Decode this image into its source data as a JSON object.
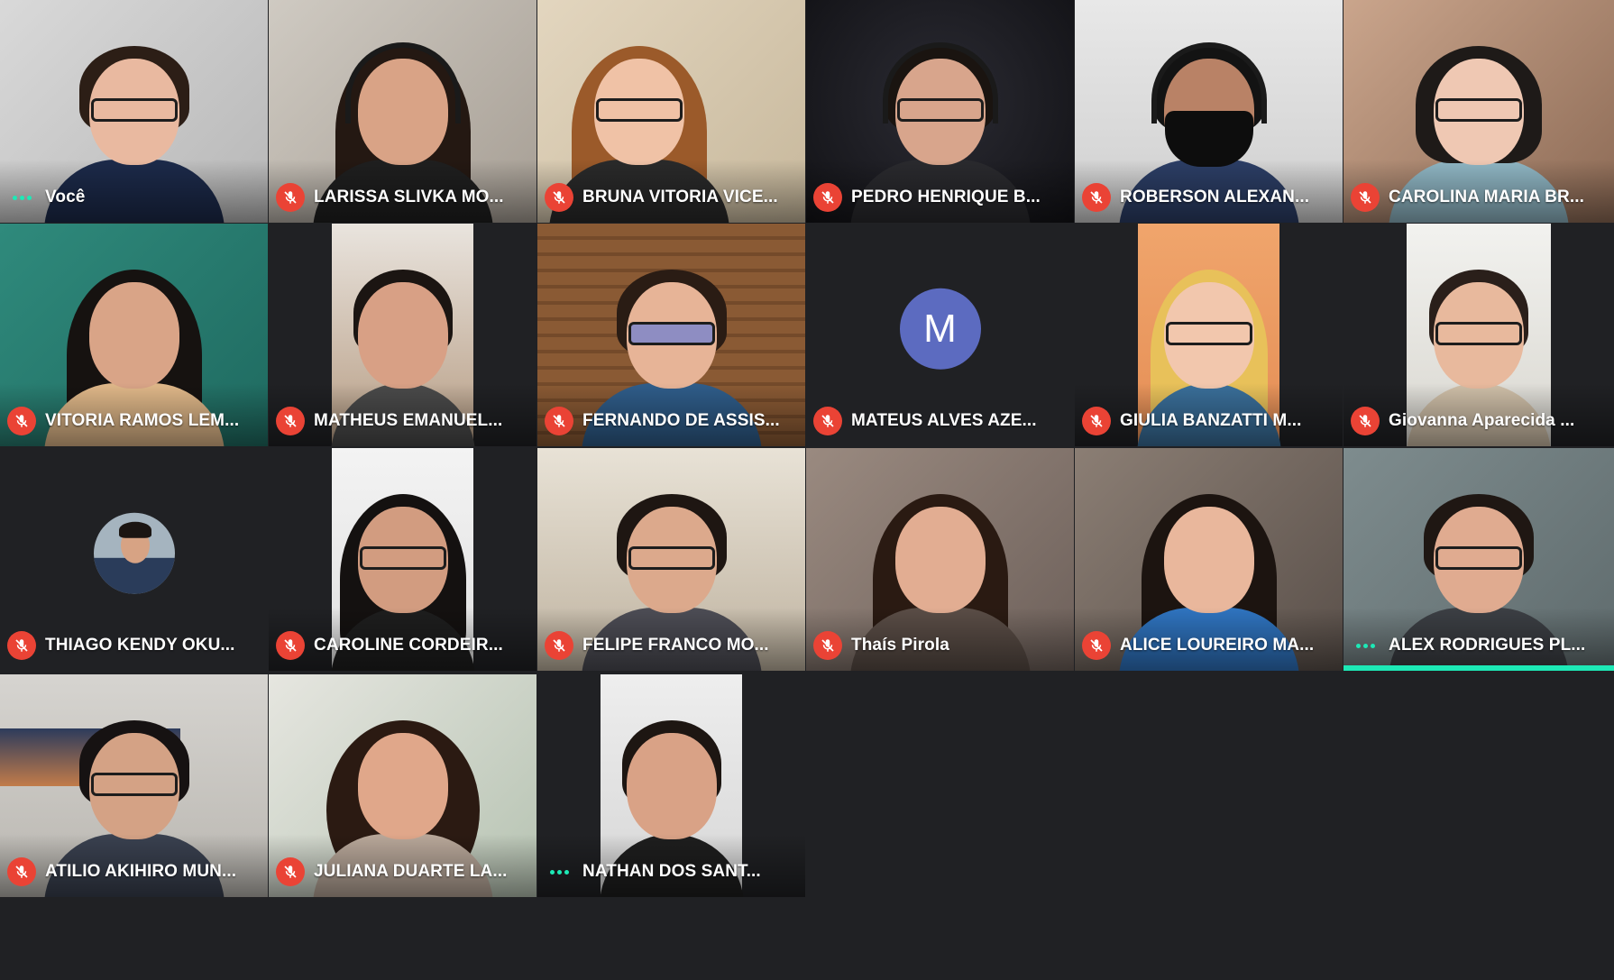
{
  "meeting": {
    "participants": [
      {
        "name": "Você",
        "status": "speaking"
      },
      {
        "name": "LARISSA SLIVKA MO...",
        "status": "muted"
      },
      {
        "name": "BRUNA VITORIA VICE...",
        "status": "muted"
      },
      {
        "name": "PEDRO HENRIQUE B...",
        "status": "muted"
      },
      {
        "name": "ROBERSON ALEXAN...",
        "status": "muted"
      },
      {
        "name": "CAROLINA MARIA BR...",
        "status": "muted"
      },
      {
        "name": "VITORIA RAMOS LEM...",
        "status": "muted"
      },
      {
        "name": "MATHEUS EMANUEL...",
        "status": "muted"
      },
      {
        "name": "FERNANDO DE ASSIS...",
        "status": "muted"
      },
      {
        "name": "MATEUS ALVES AZE...",
        "status": "muted",
        "avatar_letter": "M",
        "camera": "off"
      },
      {
        "name": "GIULIA BANZATTI M...",
        "status": "muted"
      },
      {
        "name": "Giovanna Aparecida ...",
        "status": "muted"
      },
      {
        "name": "THIAGO KENDY OKU...",
        "status": "muted",
        "camera": "off"
      },
      {
        "name": "CAROLINE CORDEIR...",
        "status": "muted"
      },
      {
        "name": "FELIPE FRANCO MO...",
        "status": "muted"
      },
      {
        "name": "Thaís Pirola",
        "status": "muted"
      },
      {
        "name": "ALICE LOUREIRO MA...",
        "status": "muted"
      },
      {
        "name": "ALEX RODRIGUES PL...",
        "status": "speaking",
        "active": true
      },
      {
        "name": "ATILIO AKIHIRO MUN...",
        "status": "muted"
      },
      {
        "name": "JULIANA DUARTE LA...",
        "status": "muted"
      },
      {
        "name": "NATHAN DOS SANT...",
        "status": "speaking"
      }
    ]
  },
  "colors": {
    "background": "#202124",
    "muted_badge": "#ea4335",
    "speaking_dots": "#1de9b6",
    "avatar": "#5c6bc0"
  },
  "icons": {
    "muted": "mic-off-icon",
    "speaking": "audio-dots-icon"
  }
}
